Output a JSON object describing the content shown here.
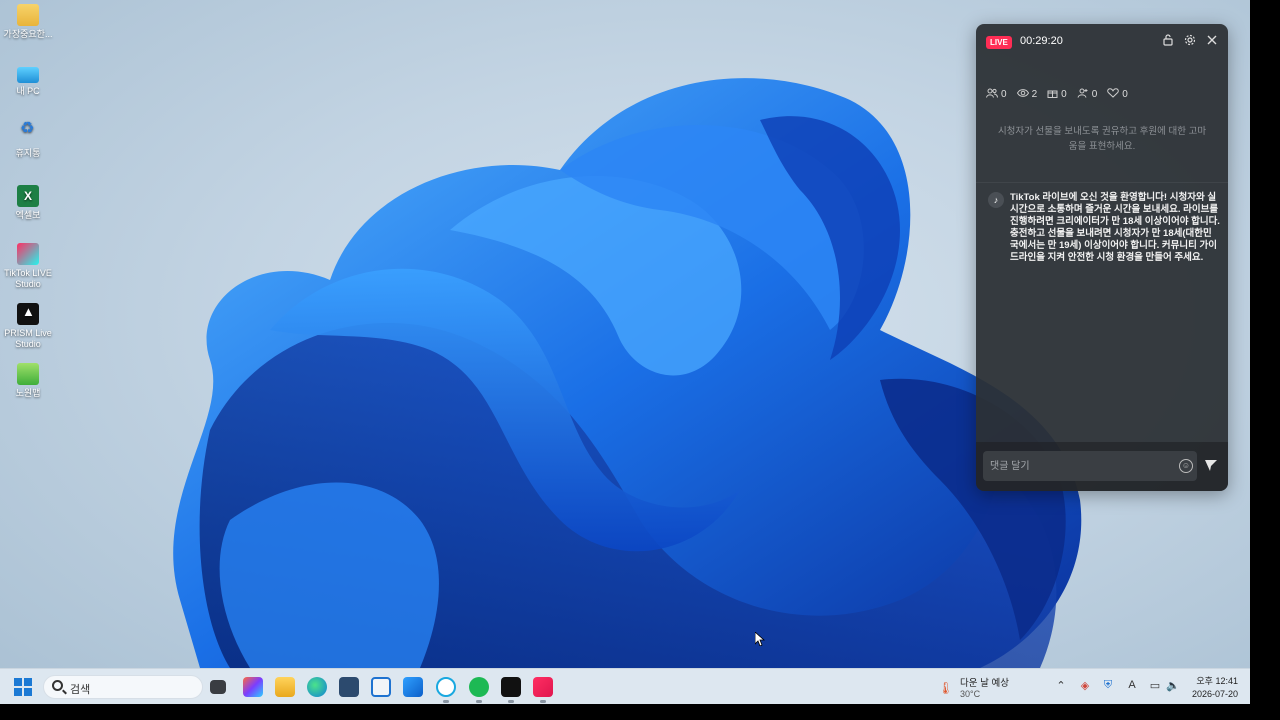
{
  "desktop": {
    "icons": [
      {
        "label": "가장중요한..."
      },
      {
        "label": "내 PC"
      },
      {
        "label": "휴지통"
      },
      {
        "label": "엑셀보"
      },
      {
        "label": "TikTok LIVE Studio"
      },
      {
        "label": "PRISM Live Studio"
      },
      {
        "label": "노원맵"
      }
    ]
  },
  "live_panel": {
    "badge": "LIVE",
    "timer": "00:29:20",
    "header_icons": [
      "unlock-icon",
      "gear-icon",
      "close-icon"
    ],
    "stats": [
      {
        "icon": "users-icon",
        "value": "0"
      },
      {
        "icon": "eye-icon",
        "value": "2"
      },
      {
        "icon": "gift-icon",
        "value": "0"
      },
      {
        "icon": "follower-icon",
        "value": "0"
      },
      {
        "icon": "heart-icon",
        "value": "0"
      }
    ],
    "gift_hint": "시청자가 선물을 보내도록 권유하고 후원에 대한 고마움을 표현하세요.",
    "system_message": "TikTok 라이브에 오신 것을 환영합니다! 시청자와 실시간으로 소통하며 즐거운 시간을 보내세요. 라이브를 진행하려면 크리에이터가 만 18세 이상이어야 합니다. 충전하고 선물을 보내려면 시청자가 만 18세(대한민국에서는 만 19세) 이상이어야 합니다. 커뮤니티 가이드라인을 지켜 안전한 시청 환경을 만들어 주세요.",
    "comment_placeholder": "댓글 달기",
    "colors": {
      "badge": "#ff2d55",
      "panel_bg": "#2c3034"
    }
  },
  "taskbar": {
    "search_label": "검색",
    "apps": [
      "file-explorer-icon",
      "edge-icon",
      "store-icon",
      "skype-icon",
      "spotify-icon",
      "prism-icon",
      "tiktok-icon"
    ],
    "weather": {
      "title": "다운 날 예상",
      "temp": "30°C"
    },
    "clock": {
      "time": "오후 12:41",
      "date": "2026-07-20"
    }
  }
}
